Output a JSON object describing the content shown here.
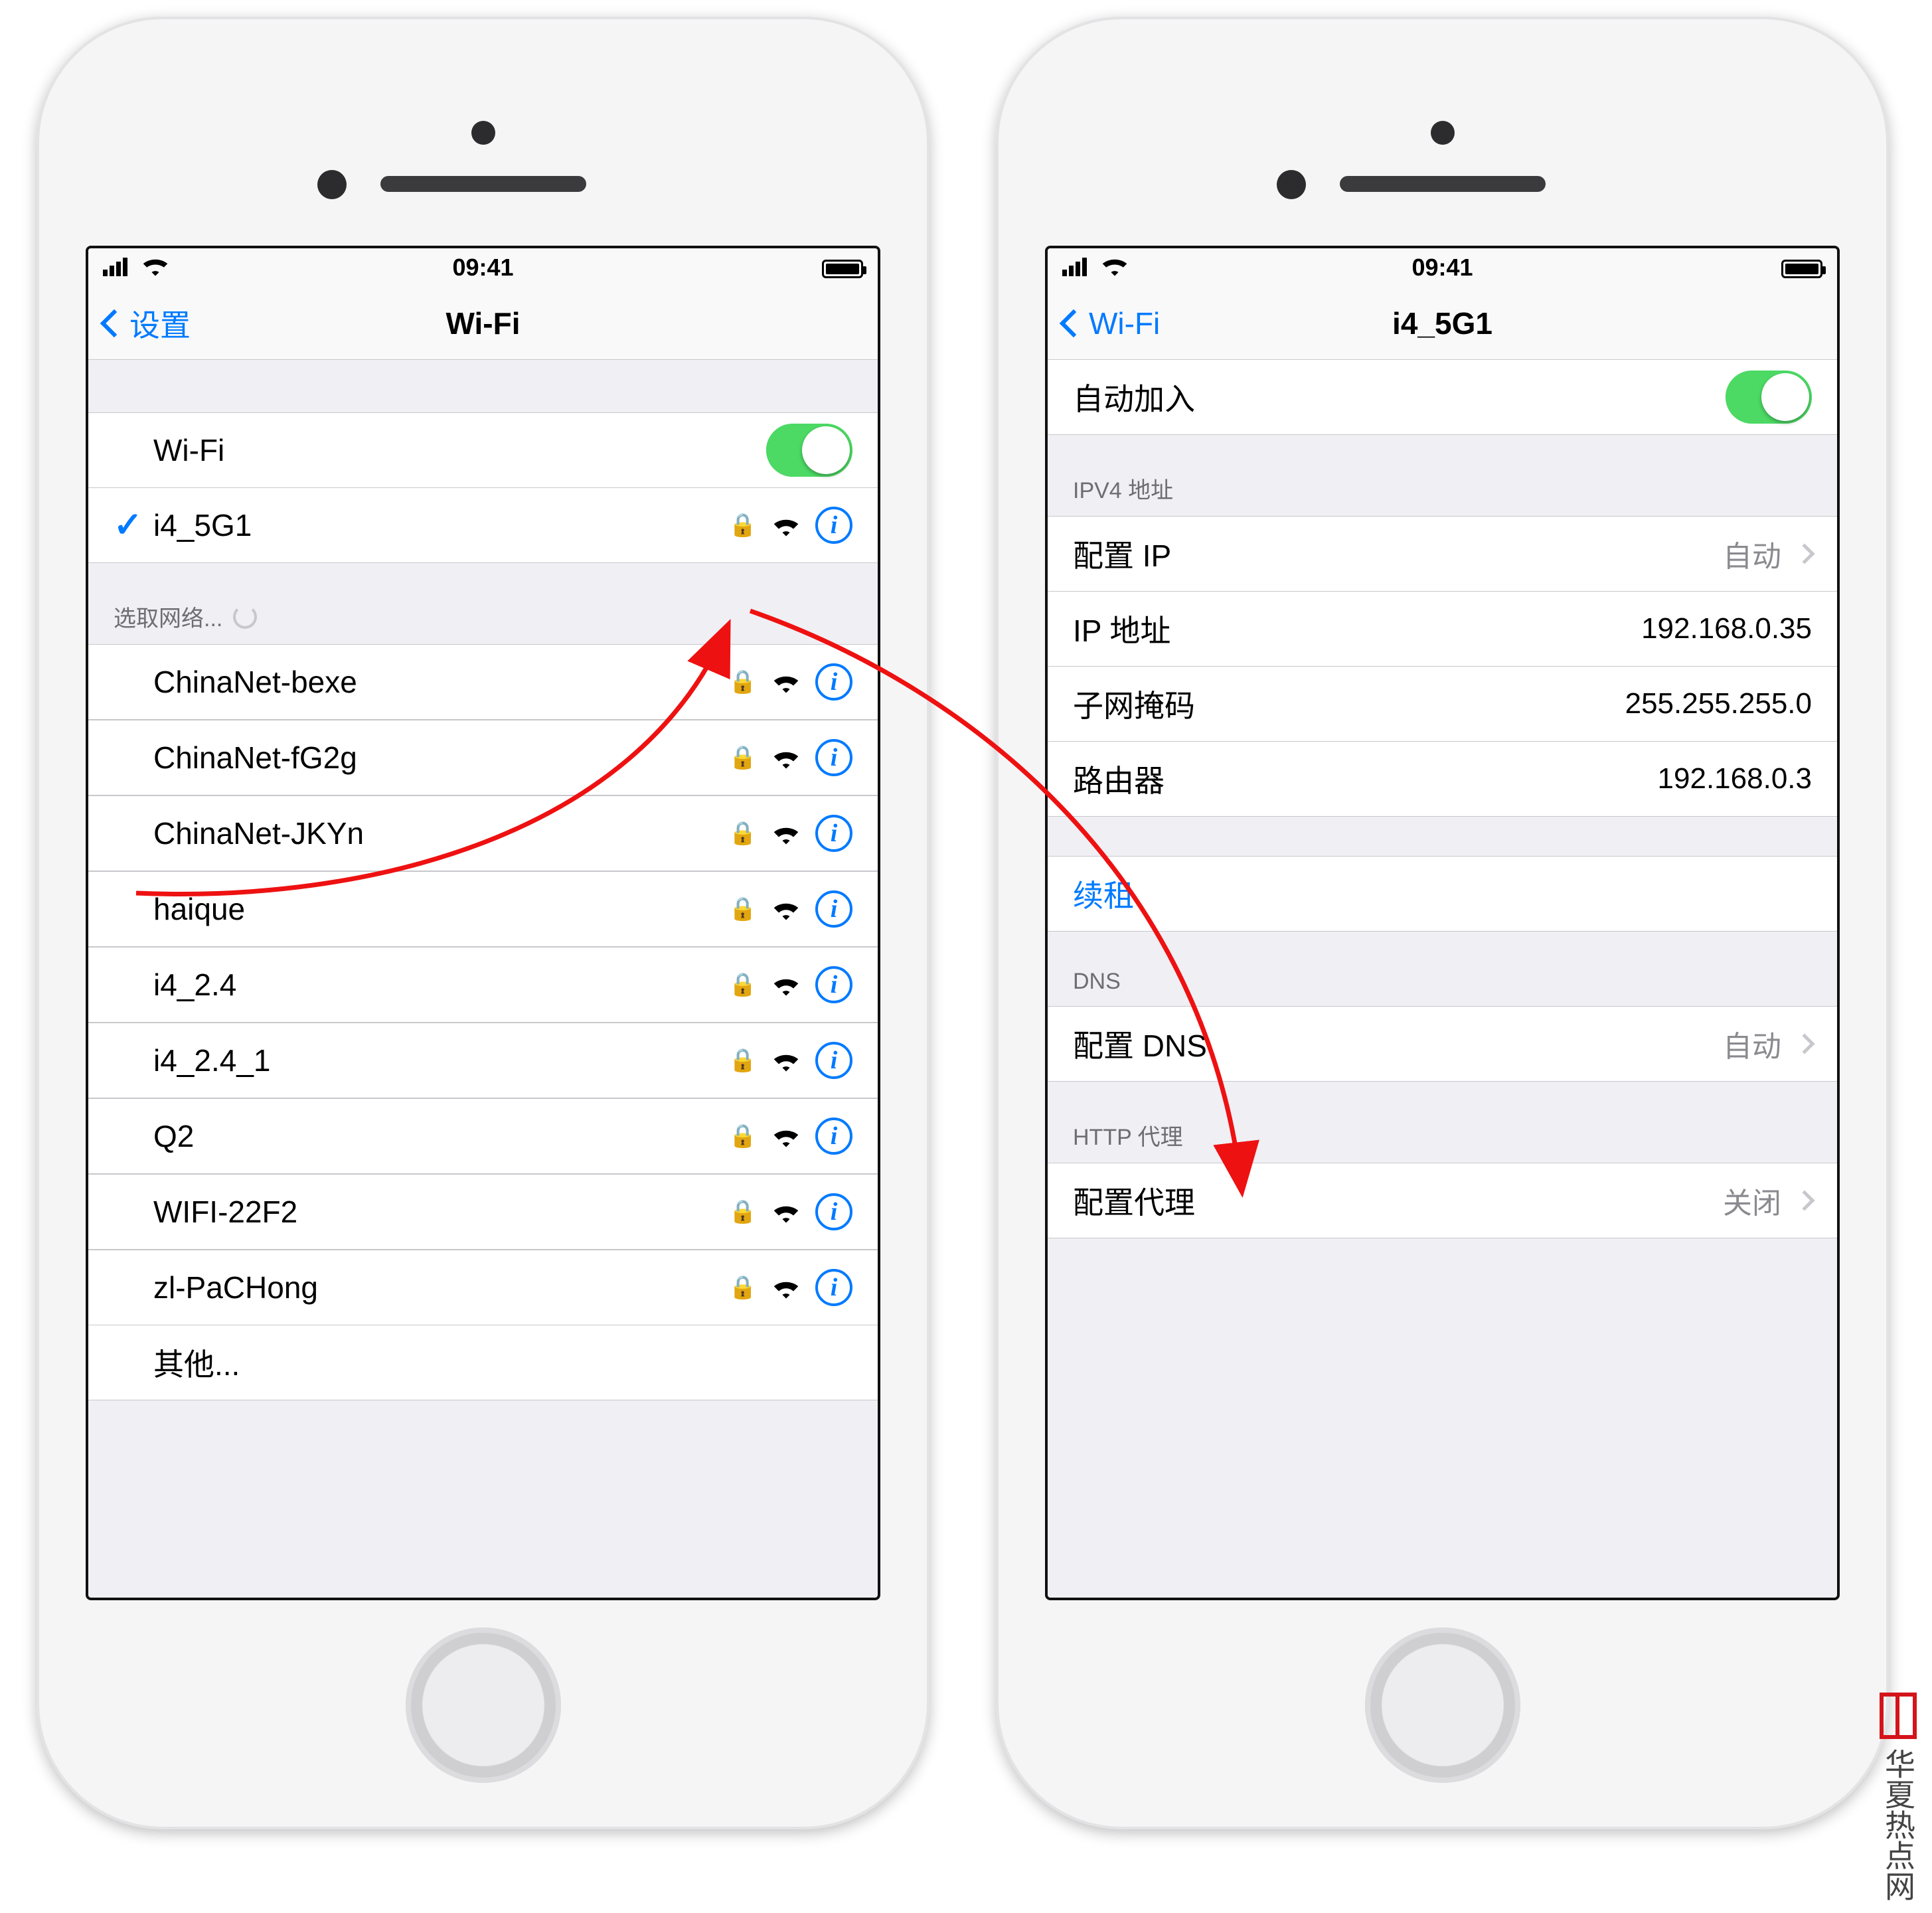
{
  "status": {
    "time": "09:41"
  },
  "left": {
    "back": "设置",
    "title": "Wi-Fi",
    "wifi_label": "Wi-Fi",
    "connected": "i4_5G1",
    "choose_header": "选取网络...",
    "networks": [
      "ChinaNet-bexe",
      "ChinaNet-fG2g",
      "ChinaNet-JKYn",
      "haique",
      "i4_2.4",
      "i4_2.4_1",
      "Q2",
      "WIFI-22F2",
      "zl-PaCHong"
    ],
    "other": "其他..."
  },
  "right": {
    "back": "Wi-Fi",
    "title": "i4_5G1",
    "auto_join": "自动加入",
    "ipv4_header": "IPV4 地址",
    "rows": {
      "configure_ip_label": "配置 IP",
      "configure_ip_value": "自动",
      "ip_label": "IP 地址",
      "ip_value": "192.168.0.35",
      "mask_label": "子网掩码",
      "mask_value": "255.255.255.0",
      "router_label": "路由器",
      "router_value": "192.168.0.3"
    },
    "renew": "续租",
    "dns_header": "DNS",
    "dns_label": "配置 DNS",
    "dns_value": "自动",
    "http_header": "HTTP 代理",
    "proxy_label": "配置代理",
    "proxy_value": "关闭"
  },
  "watermark": "华夏热点网"
}
